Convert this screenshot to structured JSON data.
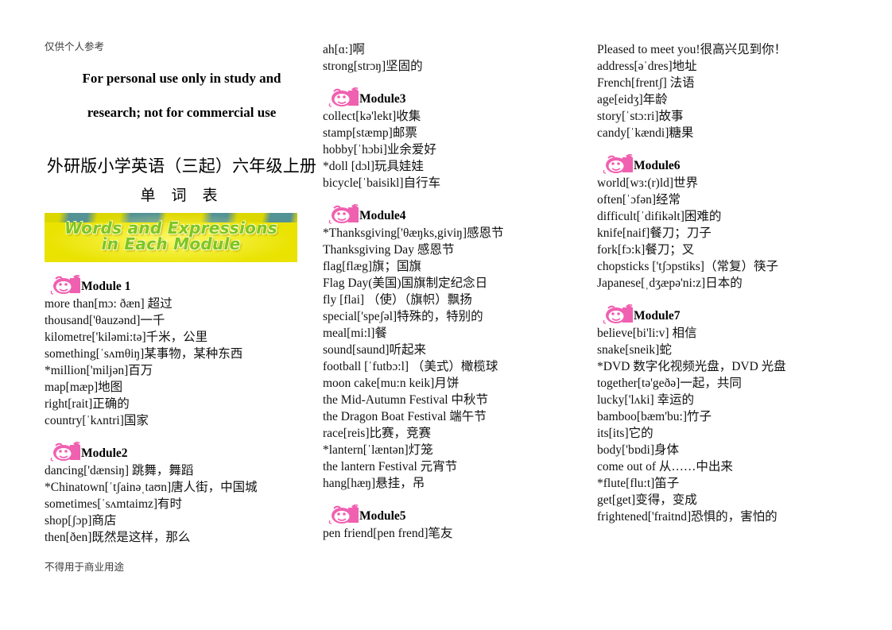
{
  "header": {
    "notice_cn_top": "仅供个人参考",
    "notice_en_line1": "For personal use only in study and",
    "notice_en_line2": "research; not for commercial use",
    "title": "外研版小学英语（三起）六年级上册",
    "subtitle": "单 词 表",
    "banner_line1": "Words and Expressions",
    "banner_line2": "in Each Module",
    "footer_cn": "不得用于商业用途"
  },
  "colors": {
    "banner_background": "#e9e200",
    "banner_text": "#7dc623",
    "banner_sky": "#2f7fb8",
    "pig_icon": "#f060b0",
    "text": "#111111"
  },
  "columns": [
    {
      "id": "column-1",
      "blocks": [
        {
          "type": "module",
          "icon": "pig-icon",
          "label": "Module 1",
          "entries": [
            "more than[mɔ: ðæn] 超过",
            "thousand['θauzənd]一千",
            "kilometre['kiləmi:tə]千米，公里",
            "something[ˈsʌmθiŋ]某事物，某种东西",
            "*million['miljən]百万",
            "map[mæp]地图",
            "right[rait]正确的",
            "country[ˈkʌntri]国家"
          ]
        },
        {
          "type": "module",
          "icon": "pig-icon",
          "label": "Module2",
          "entries": [
            "dancing['dænsiŋ] 跳舞，舞蹈",
            "*Chinatown[ˈtʃainəˌtaʊn]唐人街，中国城",
            "sometimes[ˈsʌmtaimz]有时",
            "shop[ʃɔp]商店",
            "then[ðen]既然是这样，那么"
          ]
        }
      ]
    },
    {
      "id": "column-2",
      "blocks": [
        {
          "type": "plain",
          "entries": [
            "ah[ɑ:]啊",
            "strong[strɔŋ]坚固的"
          ]
        },
        {
          "type": "module",
          "icon": "pig-icon",
          "label": "Module3",
          "entries": [
            "collect[kə'lekt]收集",
            "stamp[stæmp]邮票",
            "hobby[ˈhɔbi]业余爱好",
            "*doll [dɔl]玩具娃娃",
            "bicycle[ˈbaisikl]自行车"
          ]
        },
        {
          "type": "module",
          "icon": "pig-icon",
          "label": "Module4",
          "entries": [
            "*Thanksgiving['θæŋks,giviŋ]感恩节",
            "Thanksgiving Day 感恩节",
            "flag[flæg]旗；国旗",
            "Flag Day(美国)国旗制定纪念日",
            "fly [flai] （使）（旗帜）飘扬",
            "special['speʃəl]特殊的，特别的",
            "meal[mi:l]餐",
            "sound[saund]听起来",
            "football [ˈfutbɔ:l] （美式）橄榄球",
            "moon cake[mu:n keik]月饼",
            "the Mid-Autumn Festival 中秋节",
            "the Dragon Boat Festival 端午节",
            "race[reis]比赛，竞赛",
            "*lantern[ˈlæntən]灯笼",
            "the lantern Festival 元宵节",
            "hang[hæŋ]悬挂，吊"
          ]
        },
        {
          "type": "module",
          "icon": "pig-icon",
          "label": "Module5",
          "entries": [
            "pen friend[pen frend]笔友"
          ]
        }
      ]
    },
    {
      "id": "column-3",
      "blocks": [
        {
          "type": "plain",
          "entries": [
            "Pleased to meet you!很高兴见到你！",
            "address[əˈdres]地址",
            "French[frentʃ] 法语",
            "age[eidʒ]年龄",
            "story[ˈstɔ:ri]故事",
            "candy[ˈkændi]糖果"
          ]
        },
        {
          "type": "module",
          "icon": "pig-icon",
          "label": "Module6",
          "entries": [
            "world[wɜ:(r)ld]世界",
            "often[ˈɔfən]经常",
            "difficult[ˈdifikəlt]困难的",
            "knife[naif]餐刀；刀子",
            "fork[fɔ:k]餐刀；叉",
            "chopsticks ['tʃɔpstiks]（常复）筷子",
            "Japanese[ˌdʒæpə'ni:z]日本的"
          ]
        },
        {
          "type": "module",
          "icon": "pig-icon",
          "label": "Module7",
          "entries": [
            "believe[bi'li:v] 相信",
            "snake[sneik]蛇",
            "*DVD 数字化视频光盘，DVD 光盘",
            "together[tə'geðə]一起，共同",
            "lucky['lʌki] 幸运的",
            "bamboo[bæm'bu:]竹子",
            "its[its]它的",
            "body['bɒdi]身体",
            "come out of 从……中出来",
            "*flute[flu:t]笛子",
            "get[get]变得，变成",
            "frightened['fraitnd]恐惧的，害怕的"
          ]
        }
      ]
    }
  ]
}
